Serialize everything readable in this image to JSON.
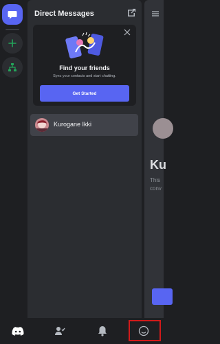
{
  "rail": {
    "dm_icon": "chat-bubble-icon",
    "add_icon": "plus-icon",
    "directory_icon": "hierarchy-icon"
  },
  "dm_panel": {
    "title": "Direct Messages",
    "new_dm_icon": "new-message-icon"
  },
  "find_friends_card": {
    "heading": "Find your friends",
    "subtext": "Sync your contacts and start chatting.",
    "button_label": "Get Started",
    "close_icon": "close-icon"
  },
  "conversations": [
    {
      "name": "Kurogane Ikki"
    }
  ],
  "peek_panel": {
    "title_fragment": "Ku",
    "line1_fragment": "This",
    "line2_fragment": "conv"
  },
  "bottom_nav": {
    "items": [
      {
        "icon": "discord-home-icon"
      },
      {
        "icon": "friends-icon"
      },
      {
        "icon": "bell-icon"
      },
      {
        "icon": "smiley-profile-icon"
      }
    ],
    "highlight_color": "#d11a1a"
  },
  "colors": {
    "accent": "#5865f2",
    "green": "#23a55a"
  }
}
